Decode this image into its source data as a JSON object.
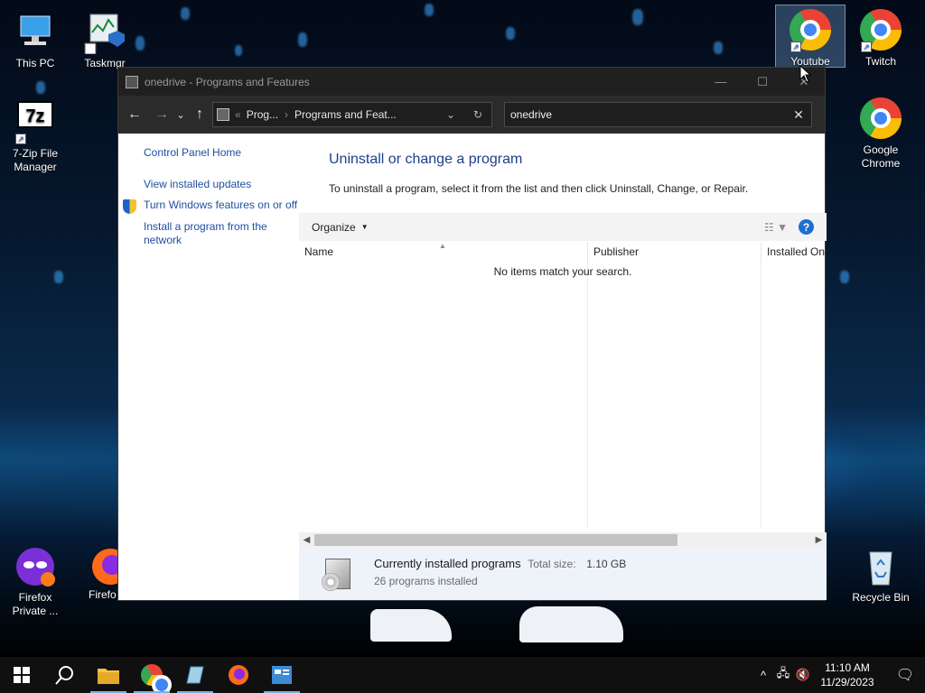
{
  "desktop": {
    "icons": [
      {
        "label": "This PC",
        "icon": "this-pc-icon"
      },
      {
        "label": "Taskmgr",
        "icon": "taskmgr-icon"
      },
      {
        "label": "Youtube",
        "icon": "chrome-icon"
      },
      {
        "label": "Twitch",
        "icon": "chrome-icon"
      },
      {
        "label": "7-Zip File Manager",
        "icon": "7zip-icon"
      },
      {
        "label": "Google Chrome",
        "icon": "chrome-icon"
      },
      {
        "label": "Firefox Private ...",
        "icon": "firefox-private-icon"
      },
      {
        "label": "Firefo",
        "icon": "firefox-icon"
      },
      {
        "label": "Recycle Bin",
        "icon": "recycle-bin-icon"
      }
    ],
    "sevenzip_badge": "7z"
  },
  "window": {
    "title": "onedrive - Programs and Features",
    "controls": {
      "minimize": "—",
      "maximize": "☐",
      "close": "✕"
    },
    "nav": {
      "back": "←",
      "forward": "→",
      "recent": "⌄",
      "up": "↑"
    },
    "address": {
      "prefix": "«",
      "crumb1": "Prog...",
      "sep": "›",
      "crumb2": "Programs and Feat...",
      "dropdown": "⌄",
      "refresh": "↻"
    },
    "search": {
      "value": "onedrive",
      "clear": "✕"
    },
    "left_pane": {
      "home": "Control Panel Home",
      "updates": "View installed updates",
      "features": "Turn Windows features on or off",
      "install": "Install a program from the network"
    },
    "main": {
      "heading": "Uninstall or change a program",
      "description": "To uninstall a program, select it from the list and then click Uninstall, Change, or Repair.",
      "organize": "Organize",
      "help": "?",
      "columns": {
        "name": "Name",
        "publisher": "Publisher",
        "installed_on": "Installed On"
      },
      "empty_message": "No items match your search."
    },
    "details": {
      "title": "Currently installed programs",
      "size_label": "Total size:",
      "size_value": "1.10 GB",
      "count": "26 programs installed"
    }
  },
  "taskbar": {
    "time": "11:10 AM",
    "date": "11/29/2023",
    "tray_chevron": "^"
  },
  "colors": {
    "link": "#1f4fa0",
    "heading": "#1e3f8c",
    "titlebar": "#202020",
    "navbar": "#2b2b2b",
    "taskbar": "#101010"
  }
}
